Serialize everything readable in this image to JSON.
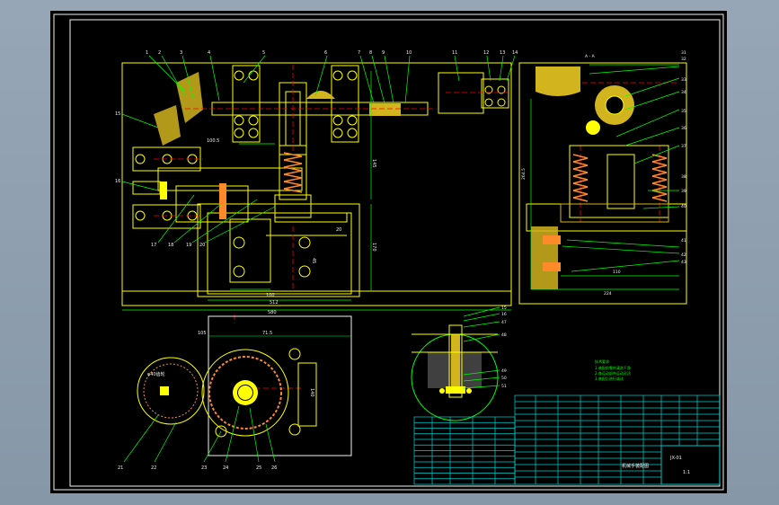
{
  "drawing": {
    "colors": {
      "background": "#000000",
      "frame": "#f2f2f2",
      "outline": "#ffff00",
      "hidden": "#ff0000",
      "annotation": "#00ff00",
      "hatch": "#ff8a2a",
      "hatch_alt": "#d2b41e",
      "table": "#00d2d2"
    },
    "balloons_main": [
      "1",
      "2",
      "3",
      "4",
      "5",
      "6",
      "7",
      "8",
      "9",
      "10",
      "11",
      "12",
      "13",
      "14"
    ],
    "balloons_left": [
      "15",
      "16"
    ],
    "balloons_bottom_main": [
      "17",
      "18",
      "19",
      "20"
    ],
    "balloons_gear": [
      "21",
      "22",
      "23",
      "24",
      "25",
      "26"
    ],
    "balloons_detail": [
      "15",
      "16",
      "47",
      "48",
      "49",
      "50",
      "51"
    ],
    "balloons_side": [
      "32",
      "33",
      "34",
      "31",
      "32",
      "33",
      "34",
      "35",
      "36",
      "37",
      "38",
      "39",
      "40",
      "41",
      "42",
      "43"
    ],
    "view_label": "A - A",
    "dimensions": {
      "d1": "100.5",
      "d2": "145",
      "d3": "170",
      "d4": "100",
      "d5": "512",
      "d6": "580",
      "d7": "105",
      "d8": "71.5",
      "d9": "140",
      "d10": "264.5",
      "d11": "110",
      "d12": "224",
      "d13": "20",
      "d14": "45"
    },
    "gear_label": "φ40齿轮",
    "tech_req_title": "技术要求",
    "tech_req_lines": [
      "1.装配前零件清洗干净",
      "2.各运动部件运动灵活",
      "3.装配后进行调试"
    ],
    "title_block_code": "JX-01",
    "title_block_name": "机械手装配图",
    "title_block_scale": "1:1",
    "table_rows": 12
  }
}
